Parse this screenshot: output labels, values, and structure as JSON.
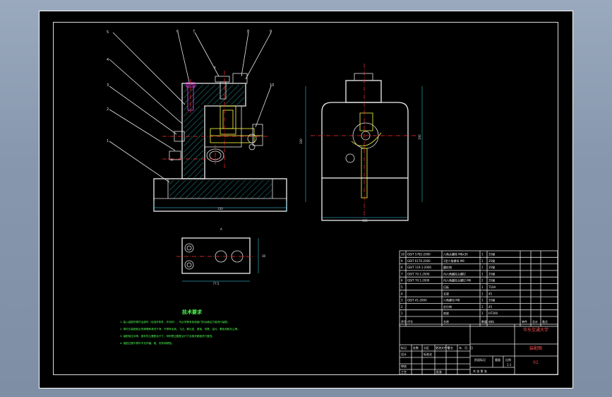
{
  "balloons": [
    "1",
    "2",
    "3",
    "4",
    "5",
    "6",
    "7",
    "8",
    "9",
    "10"
  ],
  "dimensions": {
    "front_width": "150",
    "side_width": "105",
    "side_height_left": "100",
    "side_height_right": "100",
    "top_width": "77.5",
    "top_height": "30"
  },
  "section_marks": {
    "a_top": "A",
    "a_bottom": "A",
    "view_label": "A"
  },
  "notes": {
    "title": "技术要求",
    "lines": [
      "1. 装入装配的零件及部件（包括外购件、外协件），均必须具有检验部门的合格证方能进行装配。",
      "2. 零件在装配前必须清理和清洗干净，不得有毛刺、飞边、氧化皮、锈蚀、切屑、油污、着色剂和灰尘等。",
      "3. 装配前应对零、部件的主要配合尺寸，特别是过盈配合尺寸及相关精度进行复查。",
      "4. 装配过程中零件不允许磕、碰、划伤和锈蚀。"
    ]
  },
  "bom": {
    "rows": [
      {
        "no": "10",
        "code": "GB/T 5782-2000",
        "name": "六角头螺栓 M8x30",
        "qty": "1",
        "material": "35钢"
      },
      {
        "no": "9",
        "code": "GB/T 6170-2000",
        "name": "1型六角螺母 M8",
        "qty": "1",
        "material": "35钢"
      },
      {
        "no": "8",
        "code": "GB/T 119.1-2000",
        "name": "圆柱销",
        "qty": "1",
        "material": "35钢"
      },
      {
        "no": "7",
        "code": "GB/T 70.1-2000",
        "name": "内六角圆柱头螺钉",
        "qty": "1",
        "material": "35钢"
      },
      {
        "no": "6",
        "code": "GB/T 70.1-2000",
        "name": "内六角圆柱头螺钉 M6",
        "qty": "2",
        "material": "35钢"
      },
      {
        "no": "5",
        "code": "",
        "name": "压板",
        "qty": "1",
        "material": "T10A"
      },
      {
        "no": "4",
        "code": "",
        "name": "支架",
        "qty": "1",
        "material": "45"
      },
      {
        "no": "3",
        "code": "GB/T 41-2000",
        "name": "六角螺母 M8",
        "qty": "1",
        "material": "35钢"
      },
      {
        "no": "2",
        "code": "",
        "name": "定位销",
        "qty": "1",
        "material": "45"
      },
      {
        "no": "1",
        "code": "",
        "name": "底座",
        "qty": "1",
        "material": "HT200"
      }
    ],
    "header": {
      "no": "序号",
      "code": "代号",
      "name": "名称",
      "qty": "数量",
      "material": "材料",
      "unit_weight": "单件",
      "total_weight": "总计",
      "weight": "重量",
      "remark": "备注"
    }
  },
  "title_block": {
    "school": "华东交通大学",
    "drawing_name": "装配图",
    "sheet_label": "共 张 第 张",
    "scale_label": "比例",
    "weight_label": "重量",
    "stage_label": "阶段标记",
    "scale_value": "1:1",
    "design": "设计",
    "check": "审核",
    "process": "工艺",
    "approve": "批准",
    "std": "标准化",
    "code": "01",
    "revisions": [
      "标记",
      "处数",
      "分区",
      "更改文件号",
      "签名",
      "年、月、日"
    ]
  }
}
